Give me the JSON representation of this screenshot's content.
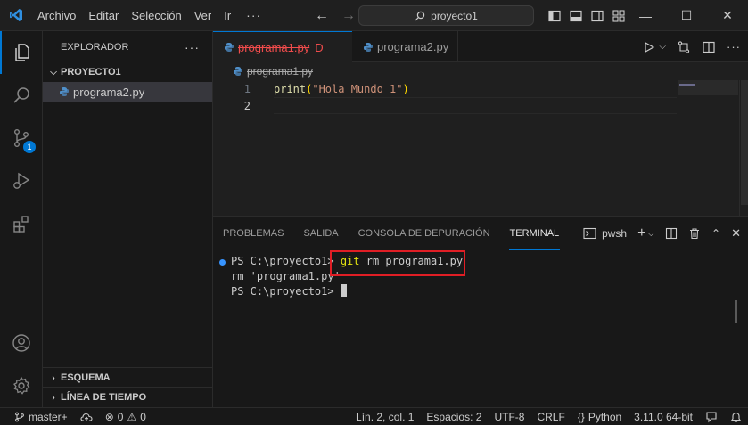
{
  "titlebar": {
    "menu": [
      "Archivo",
      "Editar",
      "Selección",
      "Ver",
      "Ir"
    ],
    "more": "···",
    "search": "proyecto1",
    "icons": [
      "vscode-logo-icon",
      "back-arrow-icon",
      "forward-arrow-icon",
      "search-icon",
      "toggle-primary-sidebar-icon",
      "toggle-panel-icon",
      "toggle-secondary-sidebar-icon",
      "customize-layout-icon"
    ],
    "window": {
      "minimize": "—",
      "maximize": "☐",
      "close": "✕"
    }
  },
  "activitybar": {
    "items": [
      "explorer-icon",
      "search-icon",
      "source-control-icon",
      "run-debug-icon",
      "extensions-icon",
      "accounts-icon",
      "manage-gear-icon"
    ],
    "scm_badge": "1",
    "accent": "#0078d4"
  },
  "sidebar": {
    "title": "EXPLORADOR",
    "more": "···",
    "project": "PROYECTO1",
    "files": [
      "programa2.py"
    ],
    "outline": "ESQUEMA",
    "timeline": "LÍNEA DE TIEMPO"
  },
  "editor": {
    "tabs": [
      {
        "label": "programa1.py",
        "flag": "D",
        "state": "deleted",
        "active": true
      },
      {
        "label": "programa2.py",
        "active": false
      }
    ],
    "breadcrumb": "programa1.py",
    "line_numbers": [
      "1",
      "2"
    ],
    "lines": [
      "print(\"Hola Mundo 1\")",
      ""
    ],
    "deleted_color": "#f14c4c"
  },
  "panel": {
    "tabs": [
      "PROBLEMAS",
      "SALIDA",
      "CONSOLA DE DEPURACIÓN",
      "TERMINAL"
    ],
    "active_tab": "TERMINAL",
    "shell": "pwsh",
    "terminal": {
      "line1_prompt": "PS C:\\proyecto1> ",
      "line1_git": "git",
      "line1_rest": " rm programa1.py",
      "line2": "rm 'programa1.py'",
      "line3_prompt": "PS C:\\proyecto1> "
    },
    "highlight_color": "#e01e25"
  },
  "statusbar": {
    "branch": "master+",
    "errors": "0",
    "warnings": "0",
    "position": "Lín. 2, col. 1",
    "spaces": "Espacios: 2",
    "encoding": "UTF-8",
    "eol": "CRLF",
    "language": "Python",
    "interpreter": "3.11.0 64-bit"
  }
}
